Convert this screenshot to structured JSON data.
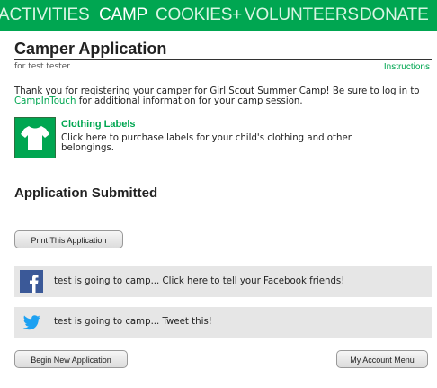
{
  "nav": {
    "items": [
      "ACTIVITIES",
      "CAMP",
      "COOKIES+",
      "VOLUNTEERS",
      "DONATE"
    ],
    "active": "CAMP"
  },
  "header": {
    "title": "Camper Application",
    "subtitle": "for test tester",
    "instructions_link": "Instructions"
  },
  "intro": {
    "text_before": "Thank you for registering your camper for Girl Scout Summer Camp! Be sure to log in to ",
    "link": "CampInTouch",
    "text_after": " for additional information for your camp session."
  },
  "clothing_labels": {
    "title": "Clothing Labels",
    "description": "Click here to purchase labels for your child's clothing and other belongings."
  },
  "status": {
    "heading": "Application Submitted"
  },
  "buttons": {
    "print": "Print This Application",
    "new_application": "Begin New Application",
    "account_menu": "My Account Menu"
  },
  "social": {
    "facebook_text": "test is going to camp... Click here to tell your Facebook friends!",
    "twitter_text": "test is going to camp... Tweet this!"
  },
  "colors": {
    "brand_green": "#00a651",
    "facebook_blue": "#3b5998",
    "twitter_blue": "#1da1f2",
    "panel_gray": "#e6e6e6"
  }
}
